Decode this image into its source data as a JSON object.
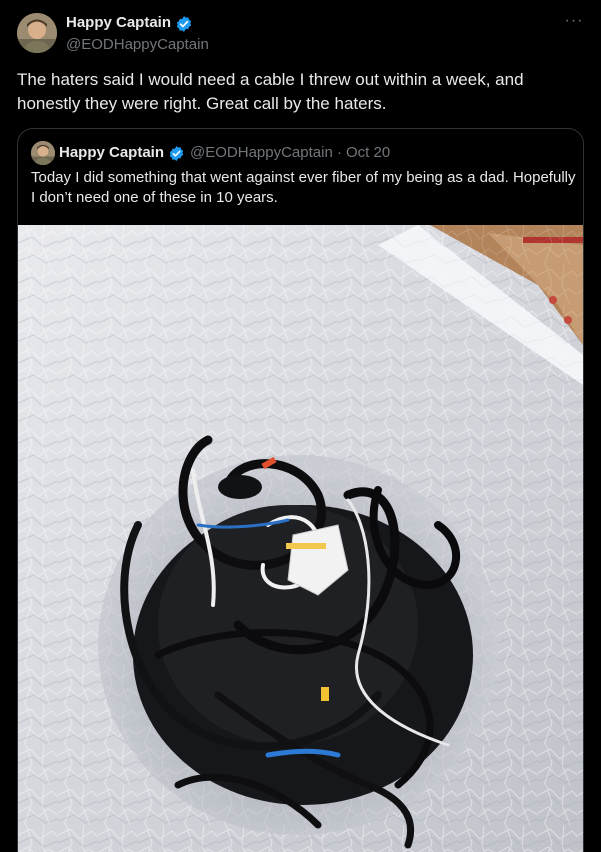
{
  "tweet": {
    "author": {
      "name": "Happy Captain",
      "handle": "@EODHappyCaptain",
      "verified": true
    },
    "more_icon": "···",
    "text": "The haters said I would need a cable I threw out within a week, and honestly they were right. Great call by the haters."
  },
  "quoted_tweet": {
    "author": {
      "name": "Happy Captain",
      "handle": "@EODHappyCaptain",
      "verified": true
    },
    "separator": "·",
    "date": "Oct 20",
    "text": "Today I did something that went against ever fiber of my being as a dad. Hopefully I don’t need one of these in 10 years."
  },
  "colors": {
    "background": "#000000",
    "text_primary": "#e7e9ea",
    "text_secondary": "#71767b",
    "verified_badge": "#1d9bf0",
    "border": "#2f3336"
  },
  "icons": {
    "verified": "verified-badge-icon",
    "more": "more-options-icon"
  }
}
